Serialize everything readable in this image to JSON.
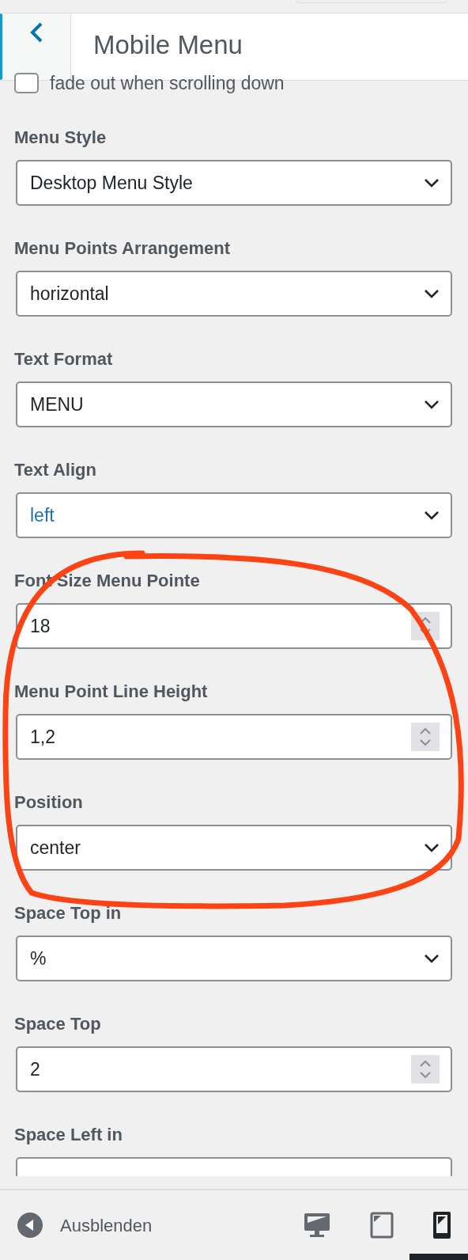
{
  "header": {
    "title": "Mobile Menu"
  },
  "checkbox": {
    "label": "fade out when scrolling down",
    "checked": false
  },
  "fields": [
    {
      "label": "Menu Style",
      "kind": "select",
      "value": "Desktop Menu Style",
      "focused": false
    },
    {
      "label": "Menu Points Arrangement",
      "kind": "select",
      "value": "horizontal",
      "focused": false
    },
    {
      "label": "Text Format",
      "kind": "select",
      "value": "MENU",
      "focused": false
    },
    {
      "label": "Text Align",
      "kind": "select",
      "value": "left",
      "focused": true
    },
    {
      "label": "Font Size Menu Pointe",
      "kind": "number",
      "value": "18",
      "focused": false
    },
    {
      "label": "Menu Point Line Height",
      "kind": "number",
      "value": "1,2",
      "focused": false
    },
    {
      "label": "Position",
      "kind": "select",
      "value": "center",
      "focused": false
    },
    {
      "label": "Space Top in",
      "kind": "select",
      "value": "%",
      "focused": false
    },
    {
      "label": "Space Top",
      "kind": "number",
      "value": "2",
      "focused": false
    },
    {
      "label": "Space Left in",
      "kind": "select"
    }
  ],
  "footer": {
    "hide_label": "Ausblenden",
    "devices": [
      {
        "kind": "desktop",
        "selected": false
      },
      {
        "kind": "tablet",
        "selected": false
      },
      {
        "kind": "mobile",
        "selected": true
      }
    ]
  }
}
